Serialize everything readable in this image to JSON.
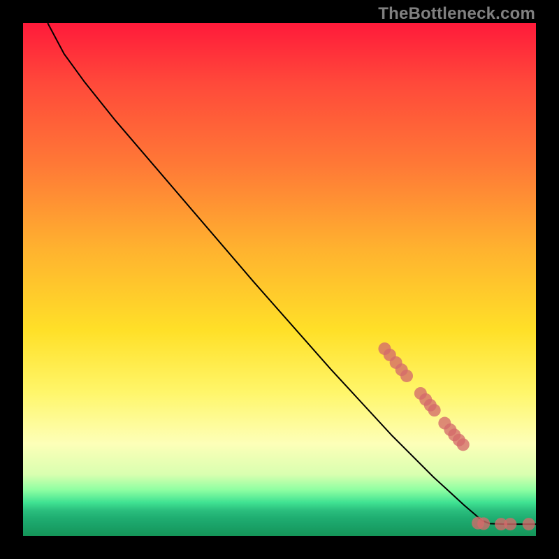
{
  "attribution": "TheBottleneck.com",
  "colors": {
    "marker": "#d46a6a",
    "curve": "#000000",
    "background": "#000000"
  },
  "chart_data": {
    "type": "line",
    "title": "",
    "xlabel": "",
    "ylabel": "",
    "xlim": [
      0,
      100
    ],
    "ylim": [
      0,
      100
    ],
    "grid": false,
    "legend": false,
    "note": "Values in percent of plot width/height. y=100 at top, y=0 at bottom; curve descends from upper-left to a flat tail at lower-right. Markers cluster along the lower-right segment and tail.",
    "curve": [
      {
        "x": 4.8,
        "y": 100.0
      },
      {
        "x": 8.0,
        "y": 94.0
      },
      {
        "x": 12.0,
        "y": 88.5
      },
      {
        "x": 18.0,
        "y": 81.0
      },
      {
        "x": 30.0,
        "y": 67.0
      },
      {
        "x": 45.0,
        "y": 49.5
      },
      {
        "x": 60.0,
        "y": 32.5
      },
      {
        "x": 72.0,
        "y": 19.5
      },
      {
        "x": 80.0,
        "y": 11.5
      },
      {
        "x": 86.0,
        "y": 6.0
      },
      {
        "x": 89.5,
        "y": 3.0
      },
      {
        "x": 91.0,
        "y": 2.4
      },
      {
        "x": 94.0,
        "y": 2.3
      },
      {
        "x": 97.0,
        "y": 2.3
      },
      {
        "x": 100.0,
        "y": 2.3
      }
    ],
    "markers": [
      {
        "x": 70.5,
        "y": 36.5
      },
      {
        "x": 71.5,
        "y": 35.3
      },
      {
        "x": 72.7,
        "y": 33.8
      },
      {
        "x": 73.8,
        "y": 32.4
      },
      {
        "x": 74.8,
        "y": 31.2
      },
      {
        "x": 77.5,
        "y": 27.8
      },
      {
        "x": 78.5,
        "y": 26.6
      },
      {
        "x": 79.4,
        "y": 25.5
      },
      {
        "x": 80.2,
        "y": 24.5
      },
      {
        "x": 82.2,
        "y": 22.0
      },
      {
        "x": 83.3,
        "y": 20.7
      },
      {
        "x": 84.1,
        "y": 19.7
      },
      {
        "x": 85.0,
        "y": 18.7
      },
      {
        "x": 85.8,
        "y": 17.8
      },
      {
        "x": 88.7,
        "y": 2.5
      },
      {
        "x": 89.8,
        "y": 2.4
      },
      {
        "x": 93.2,
        "y": 2.3
      },
      {
        "x": 95.0,
        "y": 2.3
      },
      {
        "x": 98.6,
        "y": 2.3
      }
    ]
  }
}
